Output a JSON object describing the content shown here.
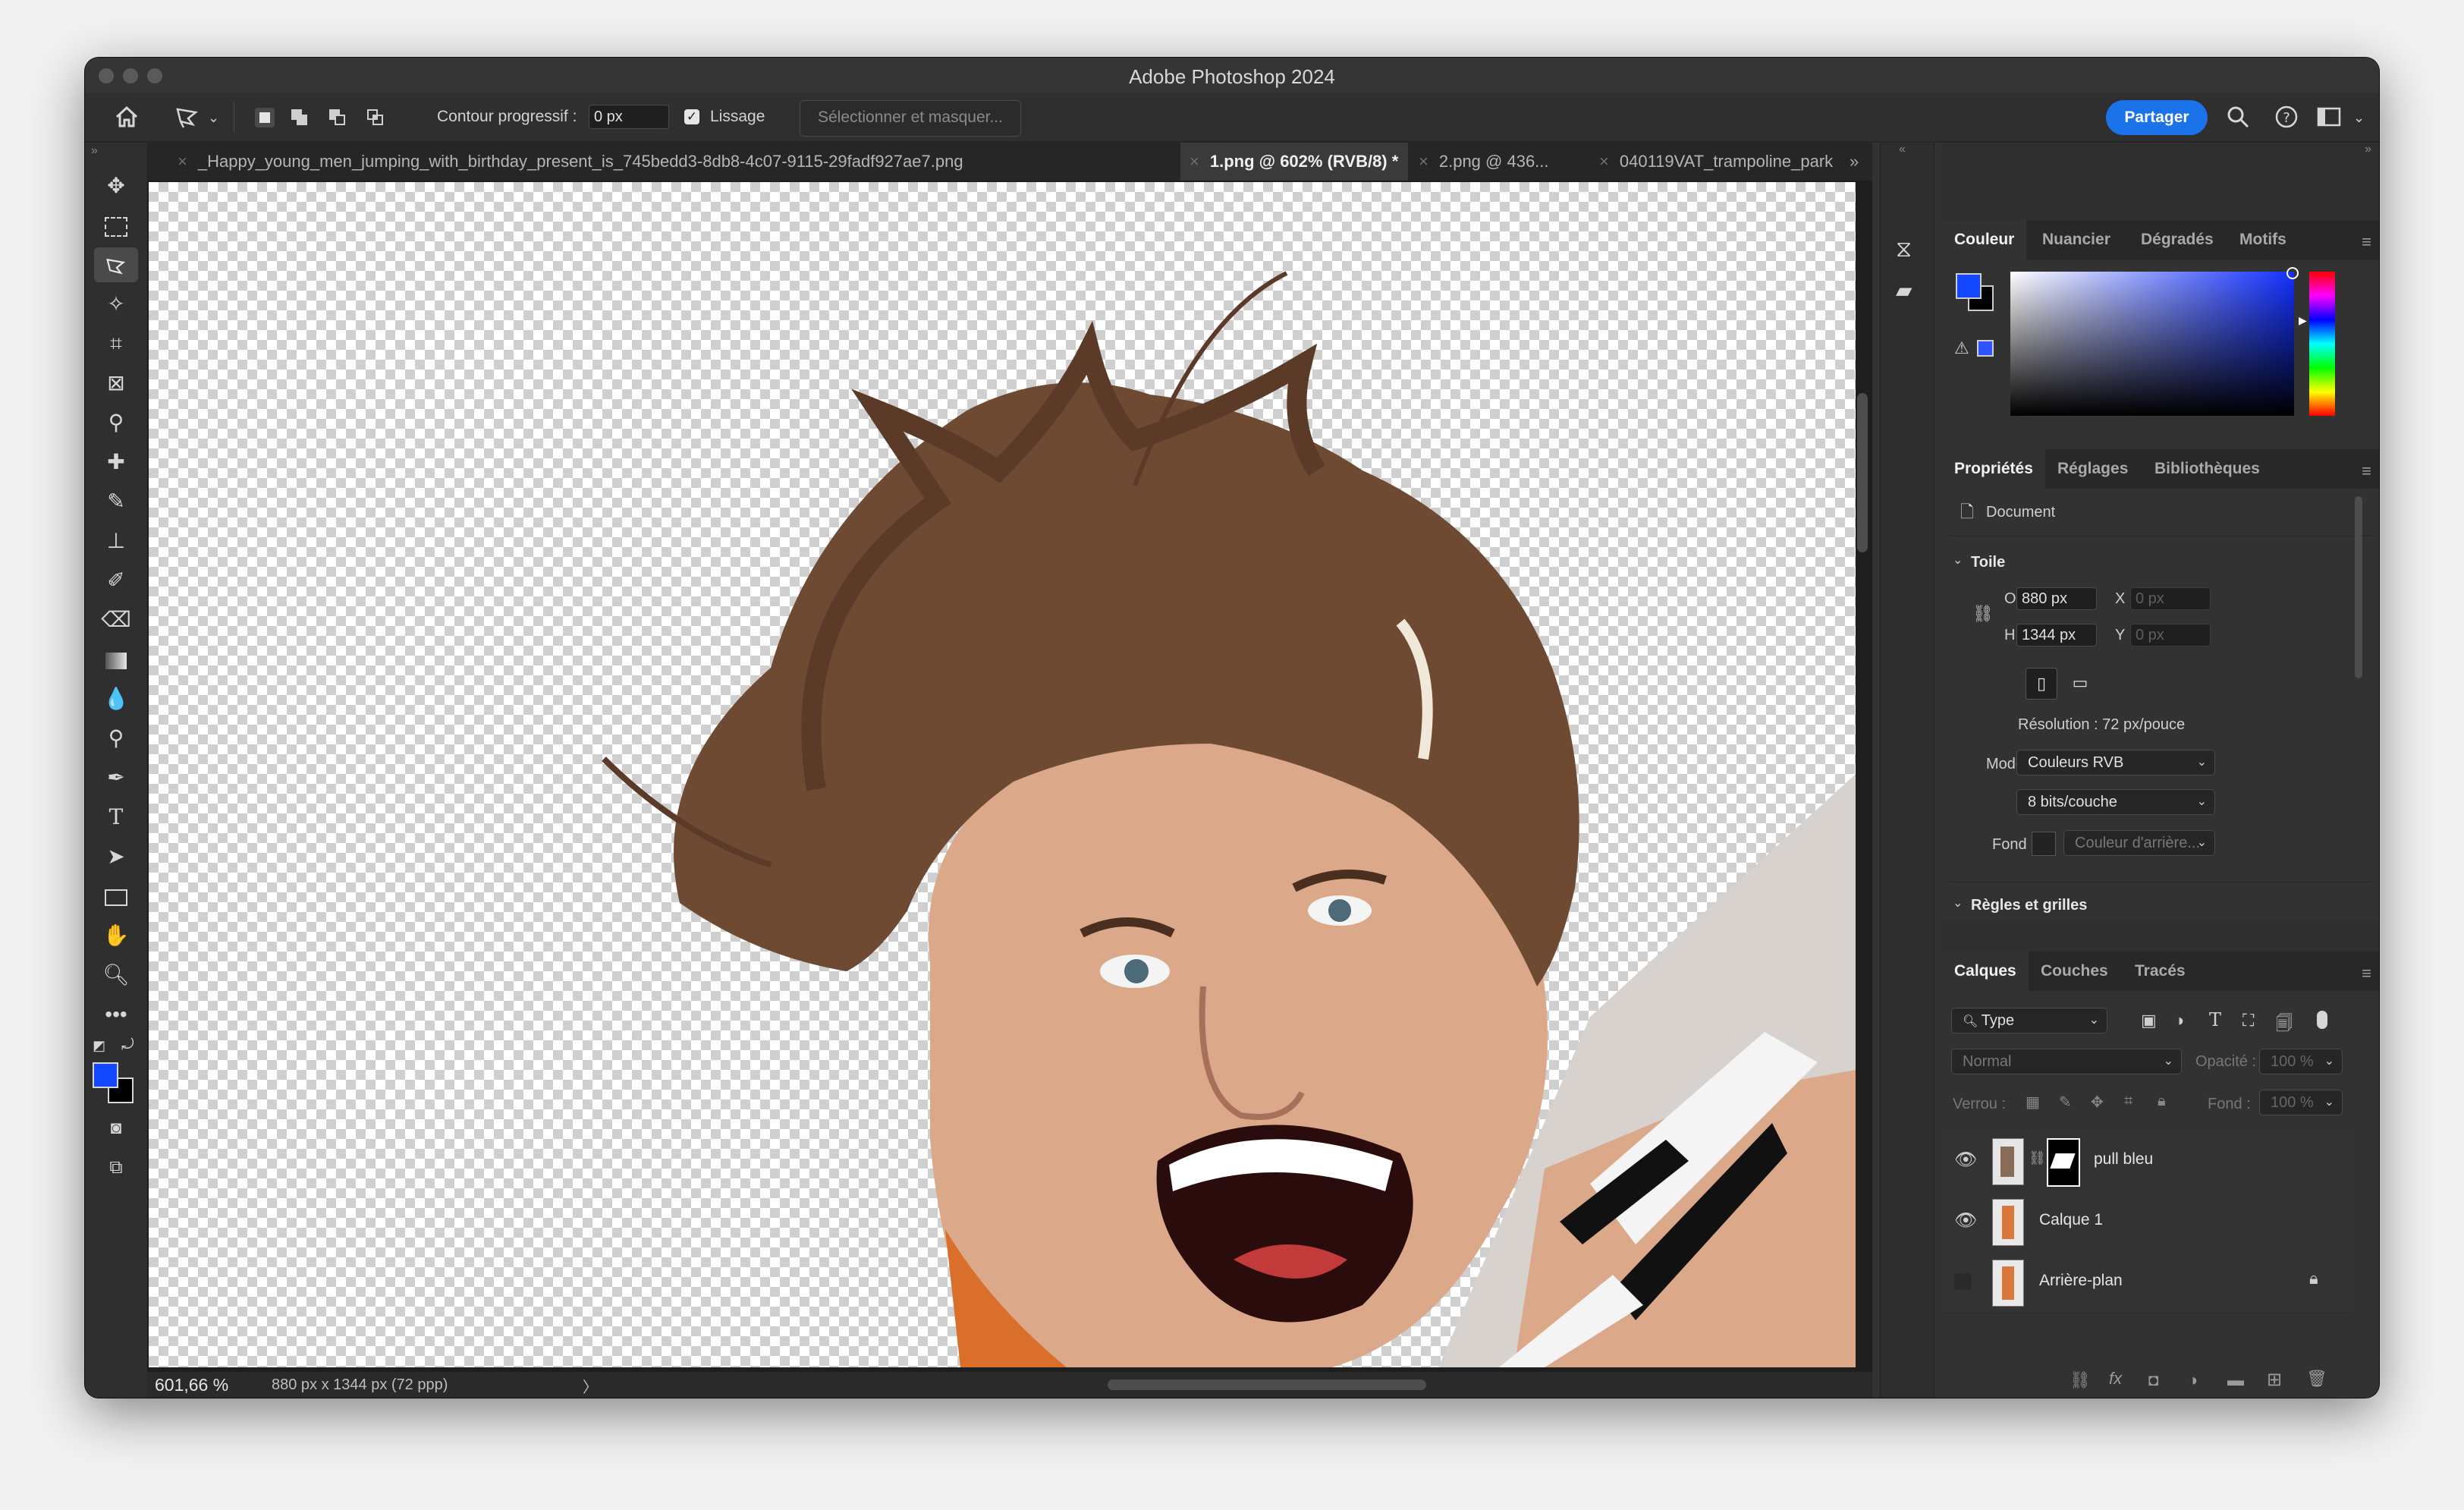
{
  "window": {
    "title": "Adobe Photoshop 2024"
  },
  "options": {
    "feather_label": "Contour progressif :",
    "feather_value": "0 px",
    "smooth_label": "Lissage",
    "smooth_checked": true,
    "select_mask_label": "Sélectionner et masquer...",
    "share_label": "Partager"
  },
  "tabs": [
    {
      "label": "_Happy_young_men_jumping_with_birthday_present_is_745bedd3-8db8-4c07-9115-29fadf927ae7.png",
      "active": false
    },
    {
      "label": "1.png @ 602% (RVB/8) *",
      "active": true
    },
    {
      "label": "2.png @ 436...",
      "active": false
    },
    {
      "label": "040119VAT_trampoline_park",
      "active": false
    }
  ],
  "status": {
    "zoom": "601,66 %",
    "doc_info": "880 px x 1344 px (72 ppp)",
    "arrow": "〉"
  },
  "color_panel": {
    "tabs": [
      "Couleur",
      "Nuancier",
      "Dégradés",
      "Motifs"
    ],
    "foreground": "#1448ff",
    "background": "#000000"
  },
  "properties": {
    "tabs": [
      "Propriétés",
      "Réglages",
      "Bibliothèques"
    ],
    "doc_label": "Document",
    "canvas_section": "Toile",
    "width_label": "O",
    "width_value": "880 px",
    "height_label": "H",
    "height_value": "1344 px",
    "x_label": "X",
    "x_value": "0 px",
    "y_label": "Y",
    "y_value": "0 px",
    "resolution": "Résolution : 72 px/pouce",
    "mode_label": "Mode",
    "mode_value": "Couleurs RVB",
    "depth_value": "8 bits/couche",
    "fill_label": "Fond",
    "fill_value": "Couleur d'arrière...",
    "rulers_section": "Règles et grilles"
  },
  "layers_panel": {
    "tabs": [
      "Calques",
      "Couches",
      "Tracés"
    ],
    "filter_type": "Type",
    "blend_mode": "Normal",
    "opacity_label": "Opacité :",
    "opacity_value": "100 %",
    "lock_label": "Verrou :",
    "fill_label": "Fond :",
    "fill_value": "100 %",
    "layers": [
      {
        "name": "pull bleu",
        "visible": true,
        "has_mask": true,
        "locked": false
      },
      {
        "name": "Calque 1",
        "visible": true,
        "has_mask": false,
        "locked": false
      },
      {
        "name": "Arrière-plan",
        "visible": false,
        "has_mask": false,
        "locked": true
      }
    ]
  },
  "icons": {
    "home": "home-icon",
    "lasso": "polygonal-lasso-icon",
    "search": "search-icon",
    "help": "help-icon",
    "workspace": "workspace-icon"
  }
}
